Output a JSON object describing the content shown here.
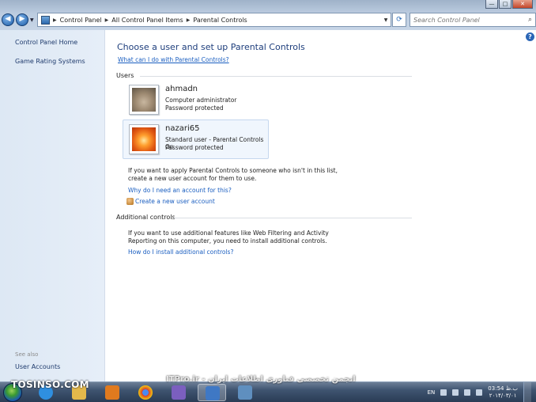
{
  "window": {
    "breadcrumb": [
      "Control Panel",
      "All Control Panel Items",
      "Parental Controls"
    ],
    "search_placeholder": "Search Control Panel",
    "help_label": "?"
  },
  "sidebar": {
    "items": [
      {
        "label": "Control Panel Home"
      },
      {
        "label": "Game Rating Systems"
      }
    ],
    "see_also": "See also",
    "see_also_items": [
      {
        "label": "User Accounts"
      }
    ]
  },
  "main": {
    "title": "Choose a user and set up Parental Controls",
    "what_link": "What can I do with Parental Controls?",
    "users_heading": "Users",
    "users": [
      {
        "name": "ahmadn",
        "line1": "Computer administrator",
        "line2": "Password protected",
        "picture": "cat"
      },
      {
        "name": "nazari65",
        "line1": "Standard user - Parental Controls On",
        "line2": "Password protected",
        "picture": "flower"
      }
    ],
    "apply_text_1": "If you want to apply Parental Controls to someone who isn't in this list,",
    "apply_text_2": "create a new user account for them to use.",
    "why_link": "Why do I need an account for this?",
    "create_link": "Create a new user account",
    "additional_heading": "Additional controls",
    "additional_text_1": "If you want to use additional features like Web Filtering and Activity",
    "additional_text_2": "Reporting on this computer, you need to install additional controls.",
    "install_link": "How do I install additional controls?"
  },
  "taskbar": {
    "brand": "TOSINSO.COM",
    "overlay": "ITPro.ir - انجمن تخصصی فناوری اطلاعات ایران",
    "language": "EN",
    "time": "03:54 ب.ظ",
    "date": "۲۰۱۴/۰۳/۰۱",
    "apps": [
      {
        "icon": "ie-icon",
        "color": "#2f8fe0"
      },
      {
        "icon": "explorer-icon",
        "color": "#e3b84b"
      },
      {
        "icon": "media-player-icon",
        "color": "#e07a1e"
      },
      {
        "icon": "chrome-icon",
        "color": "#d7402f"
      },
      {
        "icon": "app-icon",
        "color": "#7b5fbf"
      },
      {
        "icon": "control-panel-icon",
        "color": "#3f78c4"
      },
      {
        "icon": "remote-icon",
        "color": "#5f8fbf"
      }
    ]
  }
}
